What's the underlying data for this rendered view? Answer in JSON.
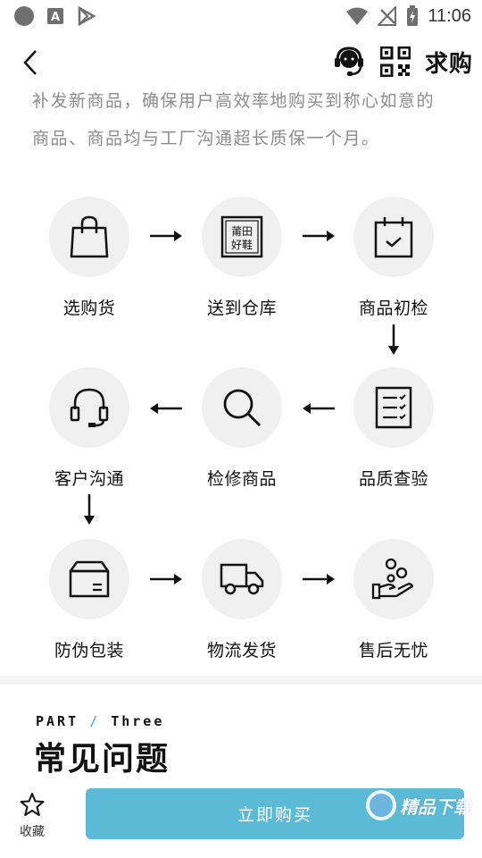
{
  "status_bar": {
    "time": "11:06"
  },
  "header": {
    "title": "求购"
  },
  "intro": {
    "line1": "补发新商品，确保用户高效率地购买到称心如意的",
    "line2": "商品、商品均与工厂沟通超长质保一个月。"
  },
  "steps": [
    {
      "label": "选购货",
      "icon": "shopping-bag-icon"
    },
    {
      "label": "送到仓库",
      "icon": "putian-shoes-stamp-icon",
      "stamp_line1": "莆田",
      "stamp_line2": "好鞋"
    },
    {
      "label": "商品初检",
      "icon": "calendar-check-icon"
    },
    {
      "label": "品质查验",
      "icon": "checklist-icon"
    },
    {
      "label": "检修商品",
      "icon": "search-icon"
    },
    {
      "label": "客户沟通",
      "icon": "headset-icon"
    },
    {
      "label": "防伪包装",
      "icon": "package-box-icon"
    },
    {
      "label": "物流发货",
      "icon": "delivery-truck-icon"
    },
    {
      "label": "售后无忧",
      "icon": "hand-care-icon"
    }
  ],
  "section": {
    "part_prefix": "PART",
    "part_slash": "/",
    "part_name": "Three",
    "title": "常见问题"
  },
  "bottom_bar": {
    "favorite_label": "收藏",
    "buy_label": "立即购买"
  },
  "watermark": {
    "text": "精品下载"
  },
  "colors": {
    "accent": "#5bbad6",
    "circle_bg": "#f0f0f0",
    "intro_text": "#8c8c8c"
  }
}
